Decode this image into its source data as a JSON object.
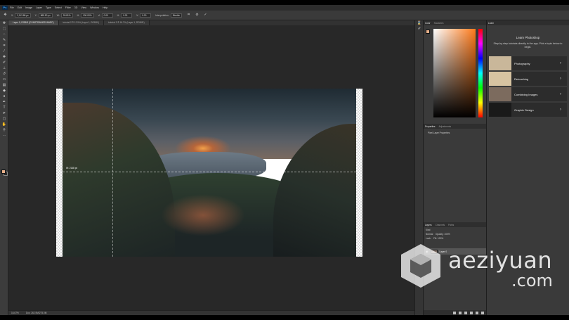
{
  "app": {
    "logo": "Ps"
  },
  "menu": [
    "File",
    "Edit",
    "Image",
    "Layer",
    "Type",
    "Select",
    "Filter",
    "3D",
    "View",
    "Window",
    "Help"
  ],
  "options": {
    "x_label": "X:",
    "x_value": "2,113.86 px",
    "y_label": "Y:",
    "y_value": "865.50 px",
    "w_label": "W:",
    "w_value": "99.81%",
    "h_label": "H:",
    "h_value": "100.00%",
    "angle_label": "∠",
    "angle_value": "0.00",
    "hskew_label": "H:",
    "hskew_value": "0.00",
    "vskew_label": "V:",
    "vskew_value": "0.00",
    "interp_label": "Interpolation:",
    "interp_value": "Bicubic"
  },
  "tabs": [
    "Layer 0, RGB/8 (CONSTRAINED WARP)",
    "tutorial 2 ® 12.5% (Layer 1, RGB/8*)",
    "tutorial 3 ® 16.7% (Layer 1, RGB/8*)"
  ],
  "measure_text": "W: 2148 px",
  "status": {
    "zoom": "16.67%",
    "doc": "Doc: 262.9M/275.0M"
  },
  "color_panel": {
    "tabs": [
      "Color",
      "Swatches"
    ],
    "fg": "#e8b08a"
  },
  "properties": {
    "tabs": [
      "Properties",
      "Adjustments"
    ],
    "title": "Pixel Layer Properties"
  },
  "layers": {
    "tabs": [
      "Layers",
      "Channels",
      "Paths"
    ],
    "kind": "Kind",
    "blend": "Normal",
    "opacity_label": "Opacity:",
    "opacity": "100%",
    "lock_label": "Lock:",
    "fill_label": "Fill:",
    "fill": "100%",
    "layer_name": "Layer 0"
  },
  "learn": {
    "header": "Learn",
    "title": "Learn Photoshop",
    "desc": "Step-by-step tutorials directly in the app. Pick a topic below to begin.",
    "cards": [
      {
        "label": "Photography",
        "thumb": "#c9b79a"
      },
      {
        "label": "Retouching",
        "thumb": "#d7c3a1"
      },
      {
        "label": "Combining Images",
        "thumb": "#7c6b5e"
      },
      {
        "label": "Graphic Design",
        "thumb": "#1a1a1a"
      }
    ]
  },
  "watermark": {
    "brand": "aeziyuan",
    "tld": ".com"
  }
}
